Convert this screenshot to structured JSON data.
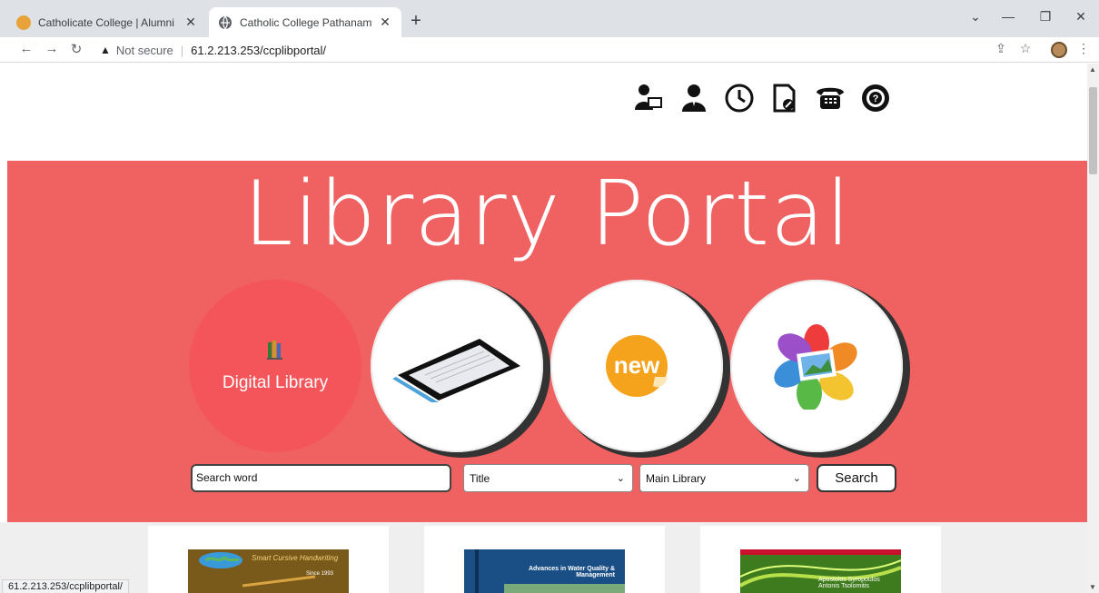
{
  "browser": {
    "tabs": [
      {
        "title": "Catholicate College | Alumni",
        "active": false
      },
      {
        "title": "Catholic College Pathanamthitta",
        "active": true
      }
    ],
    "new_tab": "+",
    "address": {
      "security": "Not secure",
      "url": "61.2.213.253/ccplibportal/"
    },
    "status_url": "61.2.213.253/ccplibportal/"
  },
  "header_icons": [
    "librarian-desk-icon",
    "staff-icon",
    "clock-icon",
    "document-edit-icon",
    "telephone-icon",
    "help-icon"
  ],
  "hero": {
    "title": "Library Portal",
    "background": "#f06262",
    "circles": [
      {
        "label": "Digital Library",
        "icon": "books-icon"
      },
      {
        "label": "",
        "icon": "tablet-icon"
      },
      {
        "label": "new",
        "icon": "new-badge-icon"
      },
      {
        "label": "",
        "icon": "photo-gallery-icon"
      }
    ]
  },
  "search": {
    "input_value": "Search word",
    "field_select": "Title",
    "library_select": "Main Library",
    "button": "Search"
  },
  "books": [
    {
      "cover_title": "Smart Cursive Handwriting",
      "cover_sub": "Since 1993"
    },
    {
      "cover_title": "Advances in Water Quality & Management",
      "cover_sub": ""
    },
    {
      "cover_title": "Apostolos Syropoulos Antonis Tsolomitis",
      "cover_sub": ""
    }
  ]
}
